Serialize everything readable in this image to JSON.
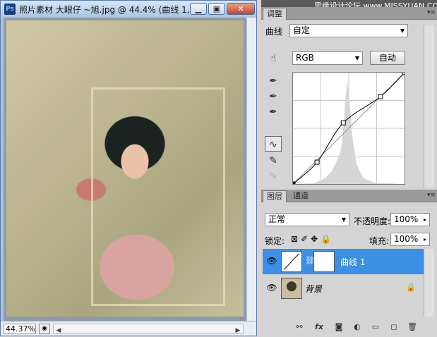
{
  "document": {
    "title": "照片素材 大眼仔 ~旭.jpg @ 44.4% (曲线 1,...",
    "app_icon_label": "Ps",
    "zoom": "44.37%"
  },
  "brand": "思缘设计论坛 www.MISSYUAN.COM",
  "adjustments_panel": {
    "tab_label": "调整",
    "preset_label": "曲线",
    "preset_value": "自定",
    "channel_value": "RGB",
    "auto_button": "自动"
  },
  "layers_panel": {
    "tabs": [
      "图层",
      "通道"
    ],
    "blend_mode": "正常",
    "opacity_label": "不透明度:",
    "opacity_value": "100%",
    "lock_label": "锁定:",
    "fill_label": "填充:",
    "fill_value": "100%",
    "layers": [
      {
        "name": "曲线 1",
        "selected": true
      },
      {
        "name": "背景",
        "selected": false,
        "locked": true
      }
    ]
  },
  "curve": {
    "points": [
      [
        0,
        0
      ],
      [
        55,
        50
      ],
      [
        115,
        140
      ],
      [
        200,
        200
      ],
      [
        255,
        255
      ]
    ]
  }
}
